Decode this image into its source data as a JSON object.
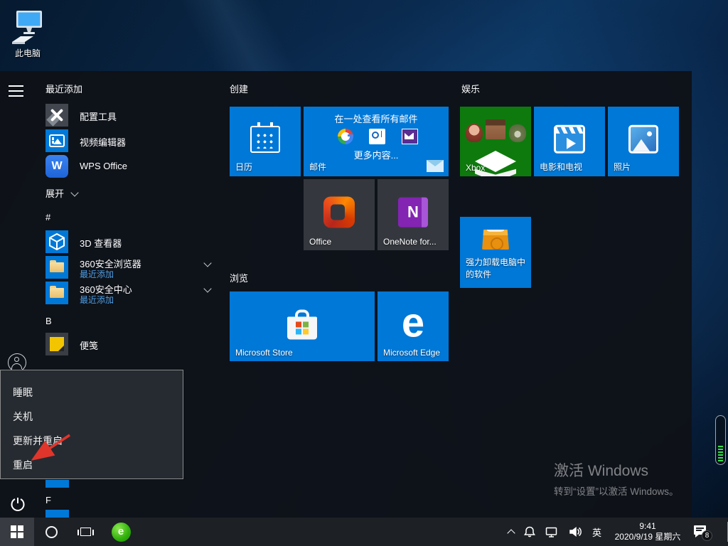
{
  "desktop": {
    "this_pc_label": "此电脑",
    "watermark_line1": "激活 Windows",
    "watermark_line2": "转到“设置”以激活 Windows。"
  },
  "start_menu": {
    "recent_header": "最近添加",
    "recent_apps": [
      {
        "label": "配置工具"
      },
      {
        "label": "视频编辑器"
      },
      {
        "label": "WPS Office"
      }
    ],
    "expand_label": "展开",
    "letter_hash": "#",
    "letter_b": "B",
    "letter_f": "F",
    "apps": [
      {
        "label": "3D 查看器"
      },
      {
        "label": "360安全浏览器",
        "sub": "最近添加"
      },
      {
        "label": "360安全中心",
        "sub": "最近添加"
      },
      {
        "label": "便笺"
      }
    ],
    "groups": {
      "create_header": "创建",
      "browse_header": "浏览",
      "entertainment_header": "娱乐"
    },
    "tiles": {
      "calendar": {
        "label": "日历"
      },
      "mail": {
        "label": "邮件",
        "promo": "在一处查看所有邮件",
        "more": "更多内容..."
      },
      "office": {
        "label": "Office"
      },
      "onenote": {
        "label": "OneNote for..."
      },
      "store": {
        "label": "Microsoft Store"
      },
      "edge": {
        "label": "Microsoft Edge"
      },
      "xbox": {
        "label": "Xbox"
      },
      "movies": {
        "label": "电影和电视"
      },
      "photos": {
        "label": "照片"
      },
      "uninstaller": {
        "label_line1": "强力卸载电脑中",
        "label_line2": "的软件"
      }
    }
  },
  "power_menu": {
    "items": [
      {
        "label": "睡眠"
      },
      {
        "label": "关机"
      },
      {
        "label": "更新并重启"
      },
      {
        "label": "重启"
      }
    ]
  },
  "taskbar": {
    "tray": {
      "lang": "英",
      "time": "9:41",
      "date": "2020/9/19 星期六",
      "badge": "8"
    }
  },
  "icons": {
    "edge_glyph": "e",
    "wps_glyph": "W",
    "onenote_glyph": "N",
    "browser360_glyph": "e"
  },
  "colors": {
    "accent_blue": "#0078d7",
    "xbox_green": "#0e7a0d",
    "recent_sub_blue": "#4f9ee3",
    "arrow_red": "#e0352b"
  }
}
